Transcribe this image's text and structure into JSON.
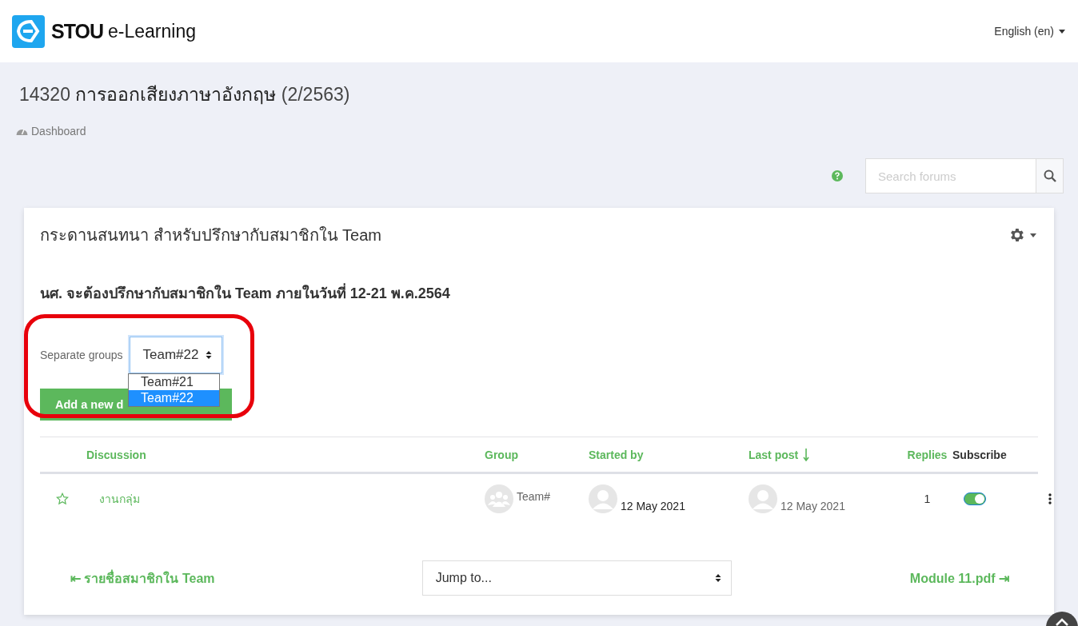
{
  "header": {
    "logo_text": "STOU",
    "logo_subtext": "e-Learning",
    "language": "English (en)"
  },
  "page_title": {
    "code": "14320",
    "name": "การออกเสียงภาษาอังกฤษ",
    "term": "(2/2563)"
  },
  "breadcrumb": [
    "Dashboard"
  ],
  "search": {
    "placeholder": "Search forums"
  },
  "forum": {
    "title": "กระดานสนทนา สำหรับปรึกษากับสมาชิกใน Team",
    "intro": "นศ. จะต้องปรึกษากับสมาชิกใน Team ภายในวันที่ 12-21 พ.ค.2564",
    "group_selector": {
      "label": "Separate groups",
      "value": "Team#22",
      "expanded": true,
      "options": [
        {
          "label": "Team#21",
          "selected": false
        },
        {
          "label": "Team#22",
          "selected": true
        }
      ]
    },
    "add_button": "Add a new d",
    "columns": [
      {
        "label": "Discussion",
        "sortable": true,
        "sorted": false
      },
      {
        "label": "Group",
        "sortable": true,
        "sorted": false
      },
      {
        "label": "Started by",
        "sortable": true,
        "sorted": false
      },
      {
        "label": "Last post",
        "sortable": true,
        "sorted": true
      },
      {
        "label": "Replies",
        "sortable": true,
        "sorted": false
      },
      {
        "label": "Subscribe",
        "sortable": false,
        "sorted": false
      }
    ],
    "rows": [
      {
        "starred": false,
        "discussion": "งานกลุ่ม",
        "group": "Team#",
        "started_date": "12 May 2021",
        "last_post_date": "12 May 2021",
        "replies": "1",
        "subscribed": true
      }
    ]
  },
  "footer": {
    "previous_arrow": "⇤",
    "previous": "รายชื่อสมาชิกใน Team",
    "jump": "Jump to...",
    "next": "Module 11.pdf",
    "next_arrow": "⇥"
  }
}
